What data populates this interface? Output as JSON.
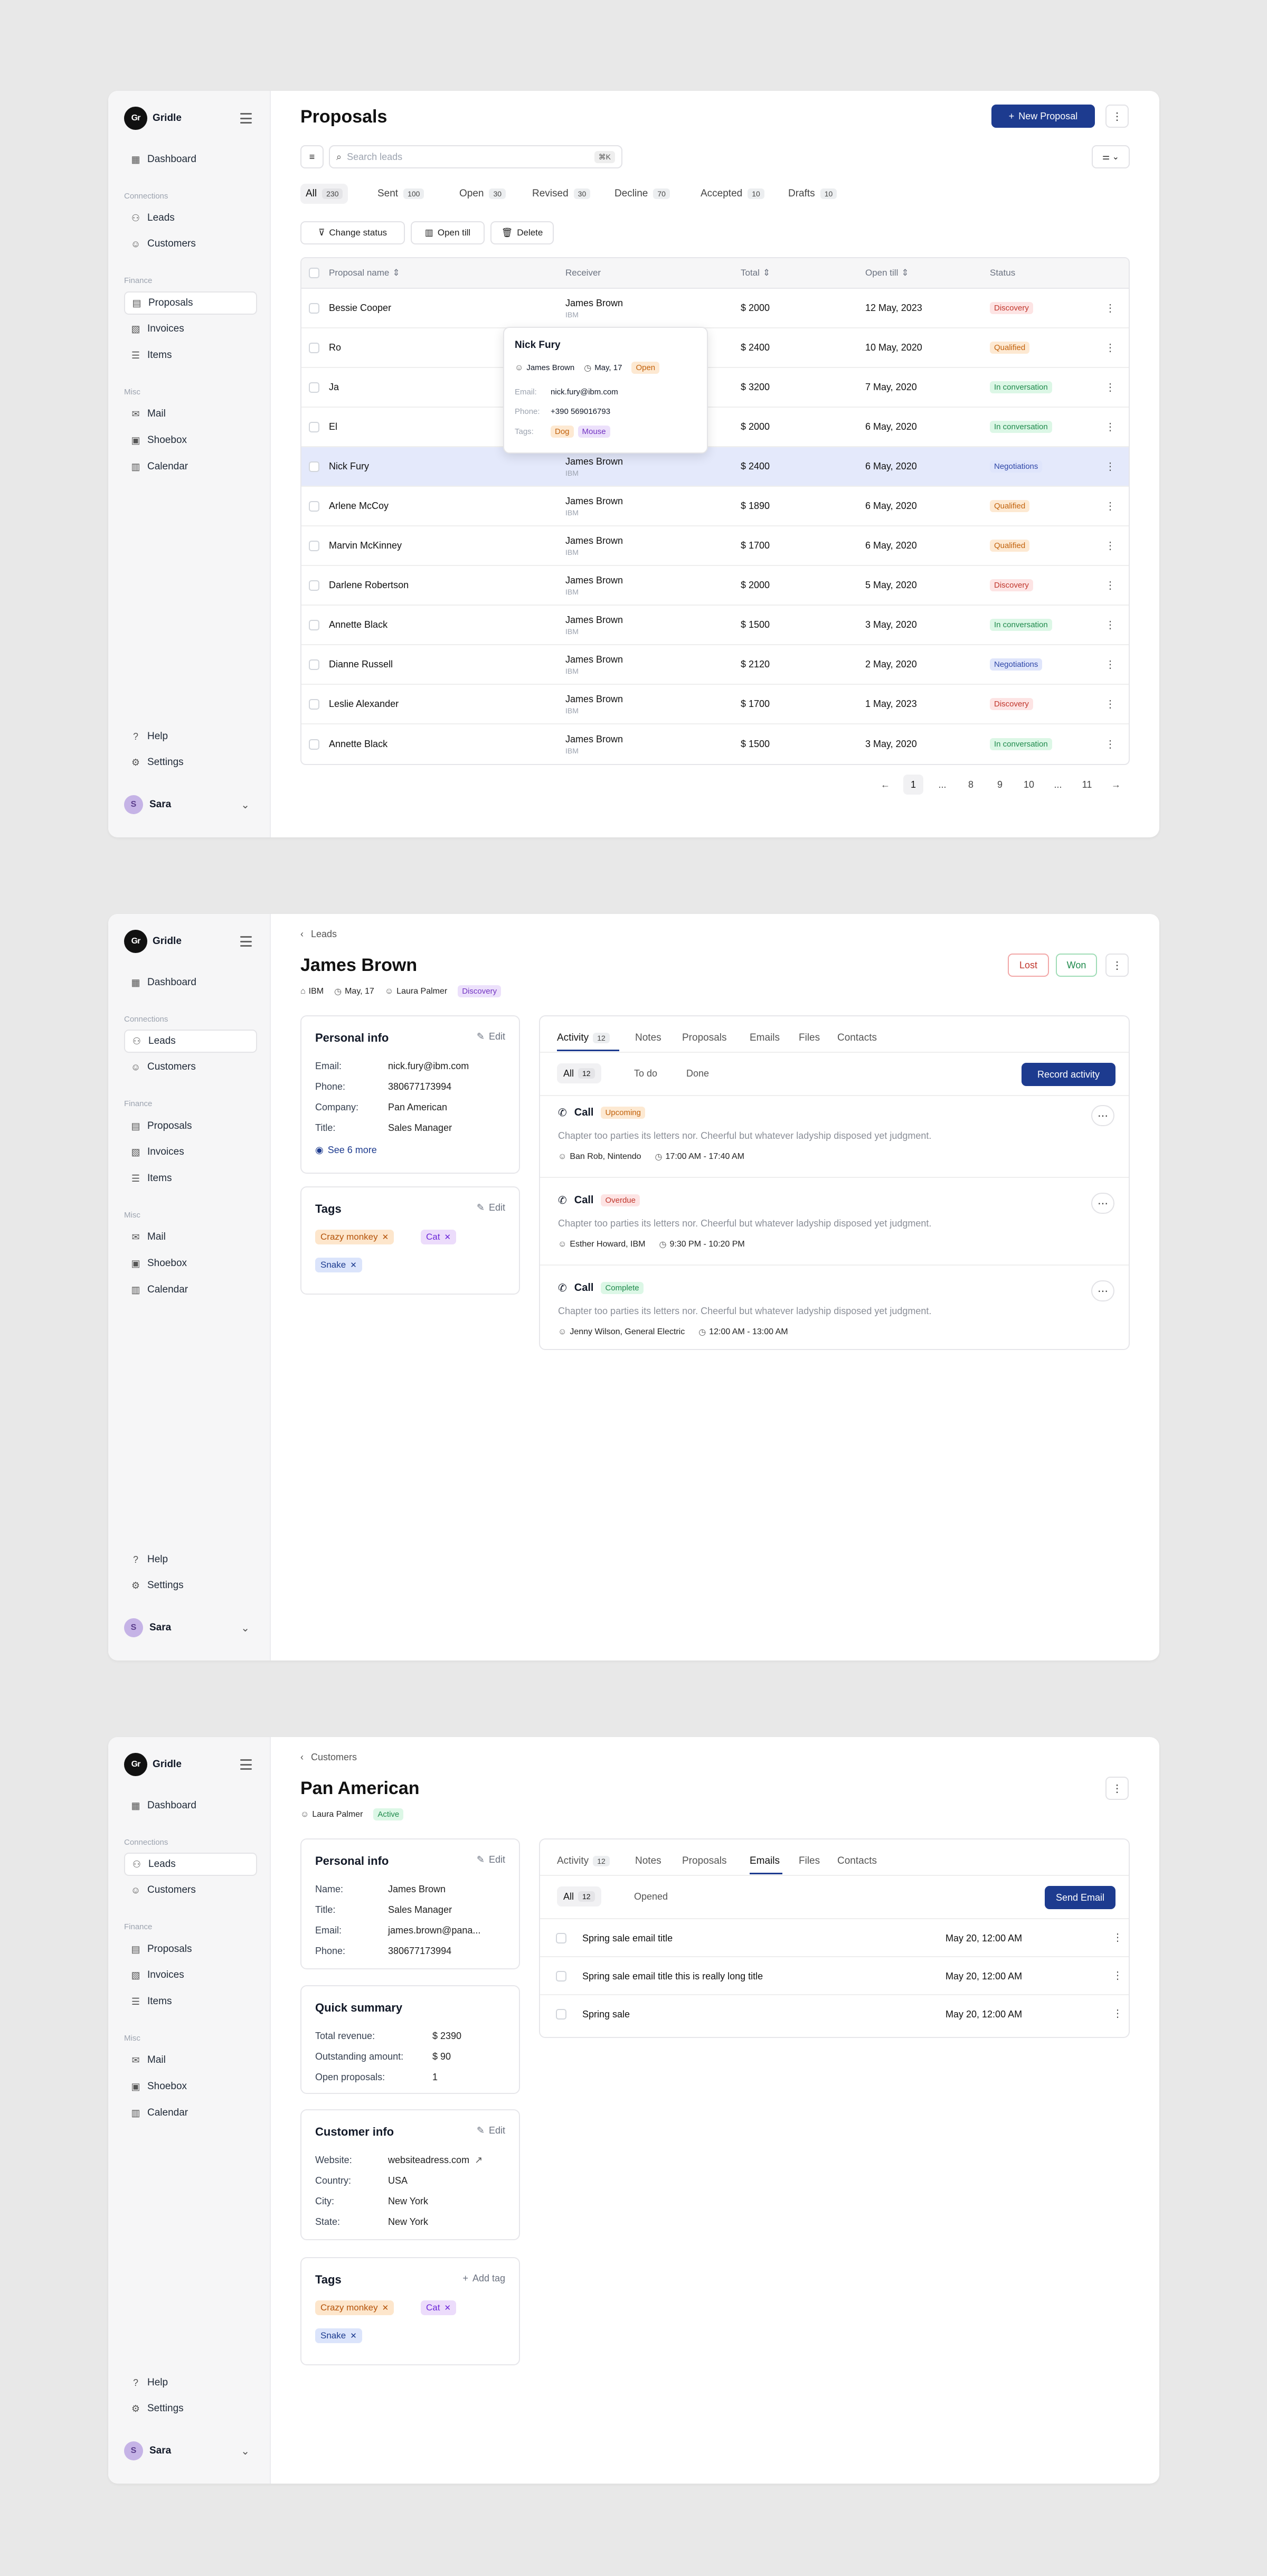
{
  "app": {
    "brand": "Gridle",
    "logo_mark": "Gr",
    "nav_groups": {
      "connections": "Connections",
      "finance": "Finance",
      "misc": "Misc"
    },
    "nav": {
      "dashboard": "Dashboard",
      "leads": "Leads",
      "customers": "Customers",
      "proposals": "Proposals",
      "invoices": "Invoices",
      "items": "Items",
      "mail": "Mail",
      "shoebox": "Shoebox",
      "calendar": "Calendar",
      "help": "Help",
      "settings": "Settings"
    },
    "user": {
      "name": "Sara",
      "initial": "S"
    }
  },
  "proposals": {
    "title": "Proposals",
    "new_button": "New Proposal",
    "search_placeholder": "Search leads",
    "shortcut": "⌘K",
    "tabs": [
      {
        "label": "All",
        "count": "230"
      },
      {
        "label": "Sent",
        "count": "100"
      },
      {
        "label": "Open",
        "count": "30"
      },
      {
        "label": "Revised",
        "count": "30"
      },
      {
        "label": "Decline",
        "count": "70"
      },
      {
        "label": "Accepted",
        "count": "10"
      },
      {
        "label": "Drafts",
        "count": "10"
      }
    ],
    "actions": {
      "change_status": "Change status",
      "open_till": "Open till",
      "delete": "Delete"
    },
    "columns": {
      "name": "Proposal name",
      "receiver": "Receiver",
      "total": "Total",
      "open_till": "Open till",
      "status": "Status"
    },
    "rows": [
      {
        "name": "Bessie Cooper",
        "receiver": "James Brown",
        "company": "IBM",
        "total": "$ 2000",
        "date": "12 May, 2023",
        "status": "Discovery"
      },
      {
        "name": "Ro",
        "receiver": "James Brown",
        "company": "IBM",
        "total": "$ 2400",
        "date": "10 May, 2020",
        "status": "Qualified"
      },
      {
        "name": "Ja",
        "receiver": "James Brown",
        "company": "IBM",
        "total": "$ 3200",
        "date": "7 May, 2020",
        "status": "In conversation"
      },
      {
        "name": "El",
        "receiver": "James Brown",
        "company": "IBM",
        "total": "$ 2000",
        "date": "6 May, 2020",
        "status": "In conversation"
      },
      {
        "name": "Nick Fury",
        "receiver": "James Brown",
        "company": "IBM",
        "total": "$ 2400",
        "date": "6 May, 2020",
        "status": "Negotiations"
      },
      {
        "name": "Arlene McCoy",
        "receiver": "James Brown",
        "company": "IBM",
        "total": "$ 1890",
        "date": "6 May, 2020",
        "status": "Qualified"
      },
      {
        "name": "Marvin McKinney",
        "receiver": "James Brown",
        "company": "IBM",
        "total": "$ 1700",
        "date": "6 May, 2020",
        "status": "Qualified"
      },
      {
        "name": "Darlene Robertson",
        "receiver": "James Brown",
        "company": "IBM",
        "total": "$ 2000",
        "date": "5 May, 2020",
        "status": "Discovery"
      },
      {
        "name": "Annette Black",
        "receiver": "James Brown",
        "company": "IBM",
        "total": "$ 1500",
        "date": "3 May, 2020",
        "status": "In conversation"
      },
      {
        "name": "Dianne Russell",
        "receiver": "James Brown",
        "company": "IBM",
        "total": "$ 2120",
        "date": "2 May, 2020",
        "status": "Negotiations"
      },
      {
        "name": "Leslie Alexander",
        "receiver": "James Brown",
        "company": "IBM",
        "total": "$ 1700",
        "date": "1 May, 2023",
        "status": "Discovery"
      },
      {
        "name": "Annette Black",
        "receiver": "James Brown",
        "company": "IBM",
        "total": "$ 1500",
        "date": "3 May, 2020",
        "status": "In conversation"
      }
    ],
    "popover": {
      "name": "Nick Fury",
      "owner": "James Brown",
      "date": "May, 17",
      "status": "Open",
      "email_label": "Email:",
      "email": "nick.fury@ibm.com",
      "phone_label": "Phone:",
      "phone": "+390 569016793",
      "tags_label": "Tags:",
      "tags": [
        "Dog",
        "Mouse"
      ]
    },
    "pagination": {
      "prev": "←",
      "next": "→",
      "pages": [
        "1",
        "...",
        "8",
        "9",
        "10",
        "...",
        "11"
      ]
    }
  },
  "lead": {
    "breadcrumb": "Leads",
    "title": "James Brown",
    "meta": {
      "company": "IBM",
      "date": "May, 17",
      "owner": "Laura Palmer",
      "status": "Discovery"
    },
    "lost": "Lost",
    "won": "Won",
    "personal": {
      "title": "Personal info",
      "edit": "Edit",
      "fields": [
        {
          "k": "Email:",
          "v": "nick.fury@ibm.com"
        },
        {
          "k": "Phone:",
          "v": "380677173994"
        },
        {
          "k": "Company:",
          "v": "Pan American"
        },
        {
          "k": "Title:",
          "v": "Sales Manager"
        }
      ],
      "see_more": "See 6 more"
    },
    "tags": {
      "title": "Tags",
      "edit": "Edit",
      "items": [
        "Crazy monkey",
        "Cat",
        "Snake"
      ]
    },
    "tabs": {
      "activity": "Activity",
      "activity_count": "12",
      "notes": "Notes",
      "proposals": "Proposals",
      "emails": "Emails",
      "files": "Files",
      "contacts": "Contacts"
    },
    "filters": {
      "all": "All",
      "all_count": "12",
      "todo": "To do",
      "done": "Done"
    },
    "record_button": "Record activity",
    "activities": [
      {
        "title": "Call",
        "badge": "Upcoming",
        "desc": "Chapter too parties its letters nor. Cheerful but whatever ladyship disposed yet judgment.",
        "people": "Ban Rob, Nintendo",
        "time": "17:00 AM - 17:40 AM"
      },
      {
        "title": "Call",
        "badge": "Overdue",
        "desc": "Chapter too parties its letters nor. Cheerful but whatever ladyship disposed yet judgment.",
        "people": "Esther Howard, IBM",
        "time": "9:30 PM - 10:20 PM"
      },
      {
        "title": "Call",
        "badge": "Complete",
        "desc": "Chapter too parties its letters nor. Cheerful but whatever ladyship disposed yet judgment.",
        "people": "Jenny Wilson, General Electric",
        "time": "12:00 AM - 13:00 AM"
      }
    ]
  },
  "customer": {
    "breadcrumb": "Customers",
    "title": "Pan American",
    "meta": {
      "owner": "Laura Palmer",
      "status": "Active"
    },
    "personal": {
      "title": "Personal info",
      "edit": "Edit",
      "fields": [
        {
          "k": "Name:",
          "v": "James Brown"
        },
        {
          "k": "Title:",
          "v": "Sales Manager"
        },
        {
          "k": "Email:",
          "v": "james.brown@pana..."
        },
        {
          "k": "Phone:",
          "v": "380677173994"
        }
      ]
    },
    "summary": {
      "title": "Quick summary",
      "fields": [
        {
          "k": "Total revenue:",
          "v": "$ 2390"
        },
        {
          "k": "Outstanding amount:",
          "v": "$ 90"
        },
        {
          "k": "Open proposals:",
          "v": "1"
        }
      ]
    },
    "info": {
      "title": "Customer info",
      "edit": "Edit",
      "fields": [
        {
          "k": "Website:",
          "v": "websiteadress.com"
        },
        {
          "k": "Country:",
          "v": "USA"
        },
        {
          "k": "City:",
          "v": "New York"
        },
        {
          "k": "State:",
          "v": "New York"
        }
      ]
    },
    "tags": {
      "title": "Tags",
      "add": "Add tag",
      "items": [
        "Crazy monkey",
        "Cat",
        "Snake"
      ]
    },
    "tabs": {
      "activity": "Activity",
      "activity_count": "12",
      "notes": "Notes",
      "proposals": "Proposals",
      "emails": "Emails",
      "files": "Files",
      "contacts": "Contacts"
    },
    "filters": {
      "all": "All",
      "all_count": "12",
      "opened": "Opened"
    },
    "send_button": "Send Email",
    "emails": [
      {
        "subject": "Spring sale email title",
        "date": "May 20, 12:00 AM"
      },
      {
        "subject": "Spring sale email title this is really long title",
        "date": "May 20, 12:00 AM"
      },
      {
        "subject": "Spring sale",
        "date": "May 20, 12:00 AM"
      }
    ]
  }
}
